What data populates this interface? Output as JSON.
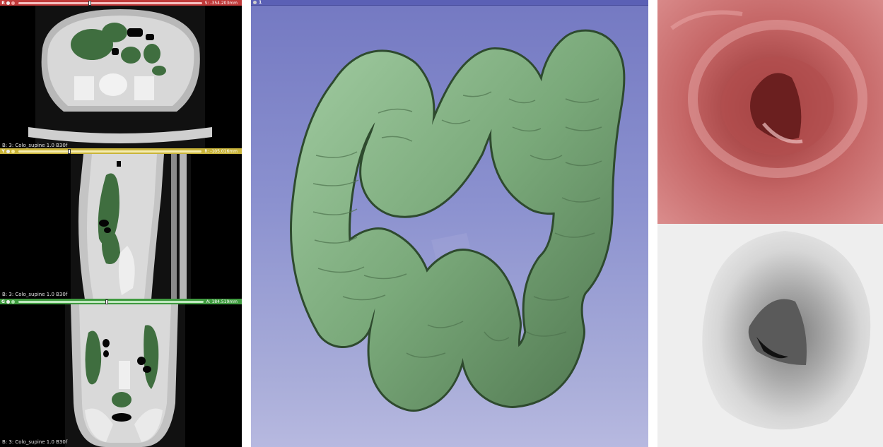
{
  "slice_views": [
    {
      "id": "R",
      "offset": "S: -354.203mm",
      "caption": "B: 3: Colo_supine  1.0  B30f",
      "color": "#e05050",
      "knob": 0.38
    },
    {
      "id": "Y",
      "offset": "R: -105.016mm",
      "caption": "B: 3: Colo_supine  1.0  B30f",
      "color": "#e6d24a",
      "knob": 0.27
    },
    {
      "id": "G",
      "offset": "A: 184.519mm",
      "caption": "B: 3: Colo_supine  1.0  B30f",
      "color": "#4fa84f",
      "knob": 0.47
    }
  ],
  "view3d": {
    "label": "1",
    "model_color": "#86b486",
    "background": "#8b91cf"
  },
  "endoscopy": {
    "color_view": "#b55a5a",
    "depth_view": "#d9d9d9"
  },
  "icons": [
    "pin-icon",
    "eye-icon",
    "link-icon"
  ]
}
